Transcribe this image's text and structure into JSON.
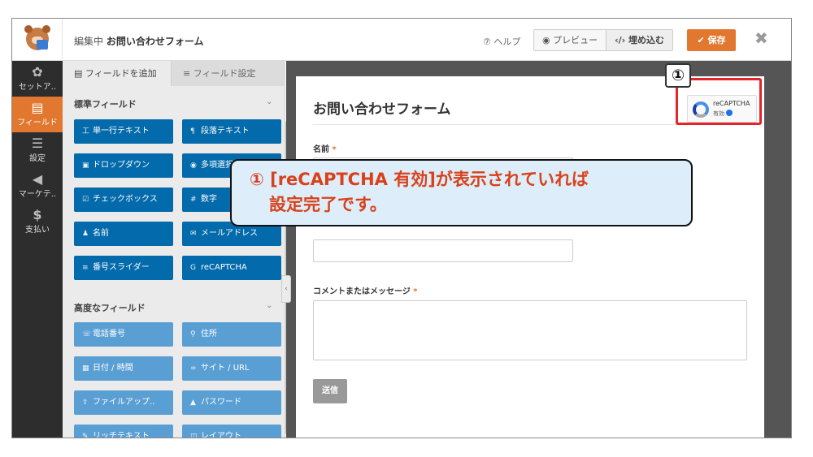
{
  "topbar": {
    "editing_prefix": "編集中",
    "form_name": "お問い合わせフォーム",
    "help": "ヘルプ",
    "preview": "プレビュー",
    "embed": "埋め込む",
    "save": "保存"
  },
  "leftnav": [
    {
      "label": "セットア..",
      "icon": "gear-icon"
    },
    {
      "label": "フィールド",
      "icon": "fields-icon"
    },
    {
      "label": "設定",
      "icon": "sliders-icon"
    },
    {
      "label": "マーケテ..",
      "icon": "megaphone-icon"
    },
    {
      "label": "支払い",
      "icon": "dollar-icon"
    }
  ],
  "panel": {
    "tab_add": "フィールドを追加",
    "tab_settings": "フィールド設定",
    "standard_title": "標準フィールド",
    "standard_fields": [
      "単一行テキスト",
      "段落テキスト",
      "ドロップダウン",
      "多項選択式",
      "チェックボックス",
      "数字",
      "名前",
      "メールアドレス",
      "番号スライダー",
      "reCAPTCHA"
    ],
    "advanced_title": "高度なフィールド",
    "advanced_fields": [
      "電話番号",
      "住所",
      "日付 / 時間",
      "サイト / URL",
      "ファイルアップ..",
      "パスワード",
      "リッチテキスト",
      "レイアウト"
    ]
  },
  "form": {
    "title": "お問い合わせフォーム",
    "recaptcha_label": "reCAPTCHA",
    "recaptcha_status": "有効",
    "name_label": "名前",
    "comment_label": "コメントまたはメッセージ",
    "required_mark": "*",
    "submit": "送信"
  },
  "annotation": {
    "number": "①",
    "line1": "① [reCAPTCHA 有効]が表示されていれば",
    "line2": "設定完了です。"
  },
  "colors": {
    "accent": "#e27730",
    "field_button": "#036aab",
    "annotation_red": "#e3242b",
    "callout_bg": "#ddeefa",
    "callout_text": "#d9411b"
  }
}
